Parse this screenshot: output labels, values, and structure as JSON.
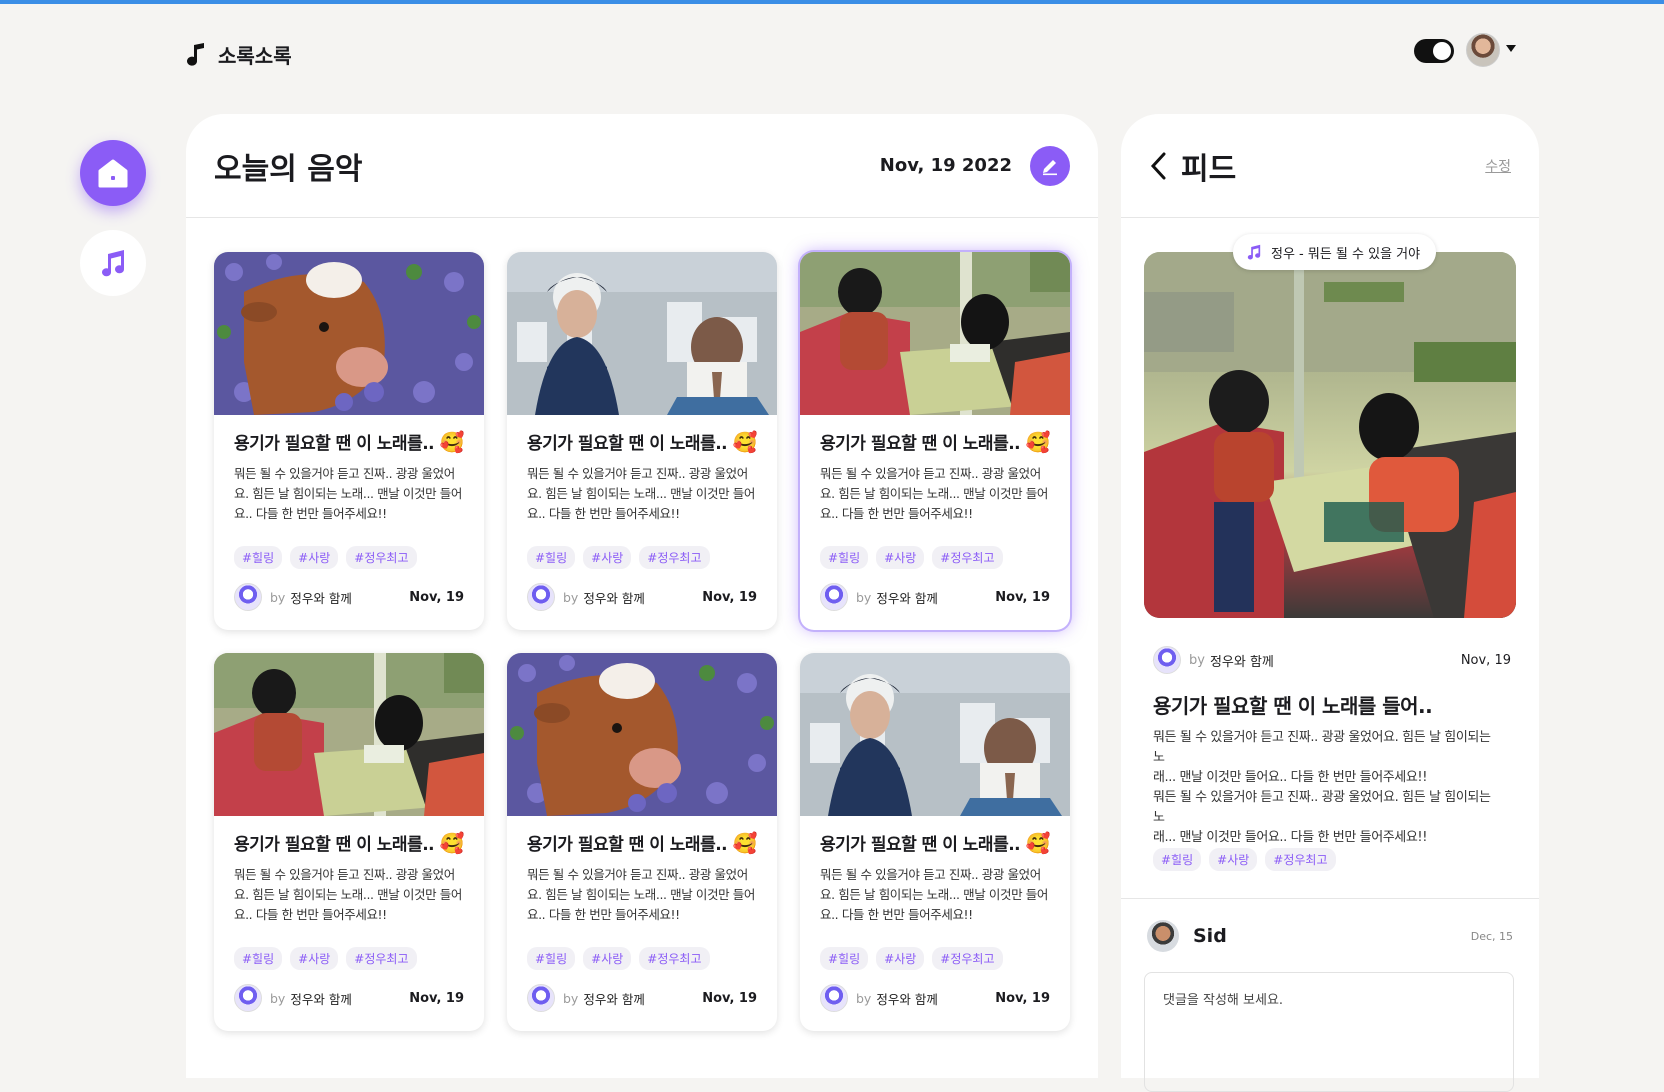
{
  "app": {
    "name": "소록소록"
  },
  "header": {
    "theme_toggle": "on"
  },
  "sidebar": {
    "items": [
      {
        "icon": "home-icon"
      },
      {
        "icon": "music-note-icon"
      }
    ]
  },
  "main": {
    "title": "오늘의 음악",
    "date": "Nov, 19 2022",
    "cards": [
      {
        "image": "cow-in-flowers",
        "title": "용기가 필요할 땐 이 노래를..",
        "emoji": "🥰",
        "desc": "뭐든 될 수 있을거야 듣고 진짜.. 광광 울었어요. 힘든 날 힘이되는 노래... 맨날 이것만 들어요.. 다들 한 번만 들어주세요!!",
        "tags": [
          "#힐링",
          "#사랑",
          "#정우최고"
        ],
        "by": "by",
        "author": "정우와 함께",
        "date": "Nov, 19"
      },
      {
        "image": "city-view",
        "title": "용기가 필요할 땐 이 노래를..",
        "emoji": "🥰",
        "desc": "뭐든 될 수 있을거야 듣고 진짜.. 광광 울었어요. 힘든 날 힘이되는 노래... 맨날 이것만 들어요.. 다들 한 번만 들어주세요!!",
        "tags": [
          "#힐링",
          "#사랑",
          "#정우최고"
        ],
        "by": "by",
        "author": "정우와 함께",
        "date": "Nov, 19"
      },
      {
        "image": "cafe-scene",
        "title": "용기가 필요할 땐 이 노래를..",
        "emoji": "🥰",
        "desc": "뭐든 될 수 있을거야 듣고 진짜.. 광광 울었어요. 힘든 날 힘이되는 노래... 맨날 이것만 들어요.. 다들 한 번만 들어주세요!!",
        "tags": [
          "#힐링",
          "#사랑",
          "#정우최고"
        ],
        "by": "by",
        "author": "정우와 함께",
        "date": "Nov, 19",
        "selected": true
      },
      {
        "image": "cafe-scene",
        "title": "용기가 필요할 땐 이 노래를..",
        "emoji": "🥰",
        "desc": "뭐든 될 수 있을거야 듣고 진짜.. 광광 울었어요. 힘든 날 힘이되는 노래... 맨날 이것만 들어요.. 다들 한 번만 들어주세요!!",
        "tags": [
          "#힐링",
          "#사랑",
          "#정우최고"
        ],
        "by": "by",
        "author": "정우와 함께",
        "date": "Nov, 19"
      },
      {
        "image": "cow-in-flowers",
        "title": "용기가 필요할 땐 이 노래를..",
        "emoji": "🥰",
        "desc": "뭐든 될 수 있을거야 듣고 진짜.. 광광 울었어요. 힘든 날 힘이되는 노래... 맨날 이것만 들어요.. 다들 한 번만 들어주세요!!",
        "tags": [
          "#힐링",
          "#사랑",
          "#정우최고"
        ],
        "by": "by",
        "author": "정우와 함께",
        "date": "Nov, 19"
      },
      {
        "image": "city-view",
        "title": "용기가 필요할 땐 이 노래를..",
        "emoji": "🥰",
        "desc": "뭐든 될 수 있을거야 듣고 진짜.. 광광 울었어요. 힘든 날 힘이되는 노래... 맨날 이것만 들어요.. 다들 한 번만 들어주세요!!",
        "tags": [
          "#힐링",
          "#사랑",
          "#정우최고"
        ],
        "by": "by",
        "author": "정우와 함께",
        "date": "Nov, 19"
      }
    ]
  },
  "feed": {
    "title": "피드",
    "edit_label": "수정",
    "song": "정우 - 뭐든 될 수 있을 거야",
    "by": "by",
    "author": "정우와 함께",
    "date": "Nov, 19",
    "post_title": "용기가 필요할 땐 이 노래를 들어..",
    "desc_lines": [
      "뭐든 될 수 있을거야 듣고 진짜.. 광광 울었어요. 힘든 날 힘이되는 노",
      "래... 맨날 이것만 들어요.. 다들 한 번만 들어주세요!!",
      "뭐든 될 수 있을거야 듣고 진짜.. 광광 울었어요. 힘든 날 힘이되는 노",
      "래... 맨날 이것만 들어요.. 다들 한 번만 들어주세요!!"
    ],
    "tags": [
      "#힐링",
      "#사랑",
      "#정우최고"
    ],
    "comment": {
      "user": "Sid",
      "date": "Dec, 15",
      "placeholder": "댓글을 작성해 보세요."
    }
  },
  "colors": {
    "accent": "#8b5cf6",
    "top_bar": "#3b8ee6",
    "background": "#f5f4f2"
  }
}
